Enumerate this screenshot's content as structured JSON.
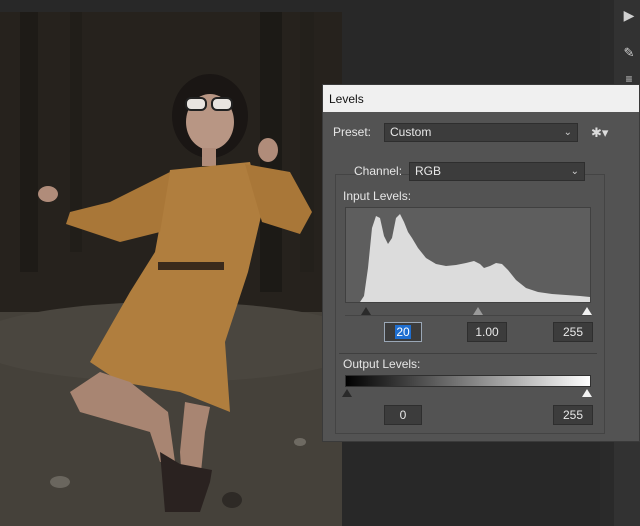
{
  "dialog": {
    "title": "Levels",
    "preset_label": "Preset:",
    "preset_value": "Custom",
    "channel_label": "Channel:",
    "channel_value": "RGB",
    "input_levels_label": "Input Levels:",
    "output_levels_label": "Output Levels:",
    "input_black": "20",
    "input_gamma": "1.00",
    "input_white": "255",
    "output_black": "0",
    "output_white": "255"
  },
  "icons": {
    "preset_menu": "gear-icon",
    "play": "play-icon",
    "brush": "brush-icon",
    "sliders": "sliders-icon",
    "eyedropper": "eyedropper-icon",
    "checkbox": "checkbox-icon"
  },
  "colors": {
    "dialog_bg": "#535353",
    "field_bg": "#3c3c3c",
    "selection": "#1f6fd1",
    "histogram_fill": "#dcdcdc"
  }
}
